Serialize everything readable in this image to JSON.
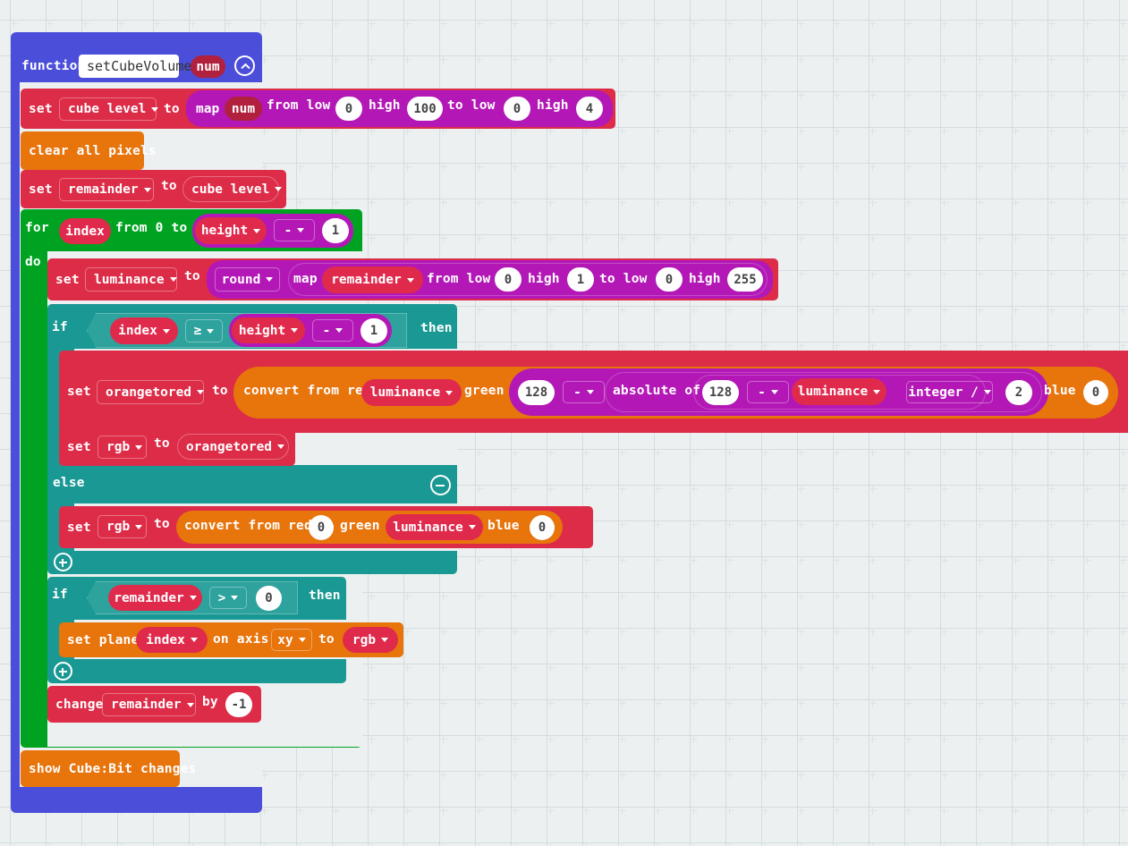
{
  "workspace": {
    "background_color": "#ecf0f1",
    "grid_spacing_px": 40
  },
  "palette": {
    "function_block": "#4b4ed8",
    "variables_block": "#dd2c48",
    "loops_block": "#00a321",
    "logic_block": "#1a9994",
    "math_block": "#b318b6",
    "cubebit_block": "#e8740c"
  },
  "function_definition": {
    "keyword": "function",
    "name": "setCubeVolume",
    "parameter": "num",
    "collapse_icon": "chevron-up-icon"
  },
  "statements": [
    {
      "id": "set-cube-level",
      "keyword": "set",
      "variable": "cube level",
      "to": "to",
      "value_block": {
        "name": "map",
        "operand": "num",
        "from_low_label": "from low",
        "from_low": "0",
        "high_label_1": "high",
        "from_high": "100",
        "to_low_label": "to low",
        "to_low": "0",
        "high_label_2": "high",
        "to_high": "4"
      }
    },
    {
      "id": "clear-all-pixels",
      "label": "clear all pixels"
    },
    {
      "id": "set-remainder",
      "keyword": "set",
      "variable": "remainder",
      "to": "to",
      "value": "cube level"
    },
    {
      "id": "for-loop",
      "keyword": "for",
      "index_var": "index",
      "from_to_label": "from 0 to",
      "limit_variable": "height",
      "operator": "-",
      "operand": "1",
      "do_label": "do"
    },
    {
      "id": "set-luminance",
      "keyword": "set",
      "variable": "luminance",
      "to": "to",
      "round_label": "round",
      "map_label": "map",
      "map_operand": "remainder",
      "from_low_label": "from low",
      "from_low": "0",
      "high_label_1": "high",
      "from_high": "1",
      "to_low_label": "to low",
      "to_low": "0",
      "high_label_2": "high",
      "to_high": "255"
    },
    {
      "id": "if-index-height",
      "keyword": "if",
      "left": "index",
      "comparator": "≥",
      "right_variable": "height",
      "right_operator": "-",
      "right_operand": "1",
      "then_label": "then"
    },
    {
      "id": "set-orangetored",
      "keyword": "set",
      "variable": "orangetored",
      "to": "to",
      "convert_label": "convert from red",
      "red_value": "luminance",
      "green_label": "green",
      "green_expr": {
        "a": "128",
        "op1": "-",
        "absolute_label": "absolute of",
        "b": "128",
        "op2": "-",
        "c": "luminance",
        "op3": "integer /",
        "d": "2"
      },
      "blue_label": "blue",
      "blue_value": "0"
    },
    {
      "id": "set-rgb-orangetored",
      "keyword": "set",
      "variable": "rgb",
      "to": "to",
      "value": "orangetored"
    },
    {
      "id": "else-branch",
      "label": "else",
      "collapse_icon": "minus-circle-icon"
    },
    {
      "id": "set-rgb-convert",
      "keyword": "set",
      "variable": "rgb",
      "to": "to",
      "convert_label": "convert from red",
      "red_value": "0",
      "green_label": "green",
      "green_value": "luminance",
      "blue_label": "blue",
      "blue_value": "0"
    },
    {
      "id": "if-expand-1",
      "expand_icon": "plus-circle-icon"
    },
    {
      "id": "if-remainder",
      "keyword": "if",
      "left": "remainder",
      "comparator": ">",
      "right": "0",
      "then_label": "then"
    },
    {
      "id": "set-plane",
      "label_1": "set plane",
      "plane_value": "index",
      "label_2": "on axis",
      "axis": "xy",
      "label_3": "to",
      "color_value": "rgb"
    },
    {
      "id": "if-expand-2",
      "expand_icon": "plus-circle-icon"
    },
    {
      "id": "change-remainder",
      "keyword": "change",
      "variable": "remainder",
      "by_label": "by",
      "amount": "-1"
    },
    {
      "id": "show-changes",
      "label": "show Cube:Bit changes"
    }
  ]
}
